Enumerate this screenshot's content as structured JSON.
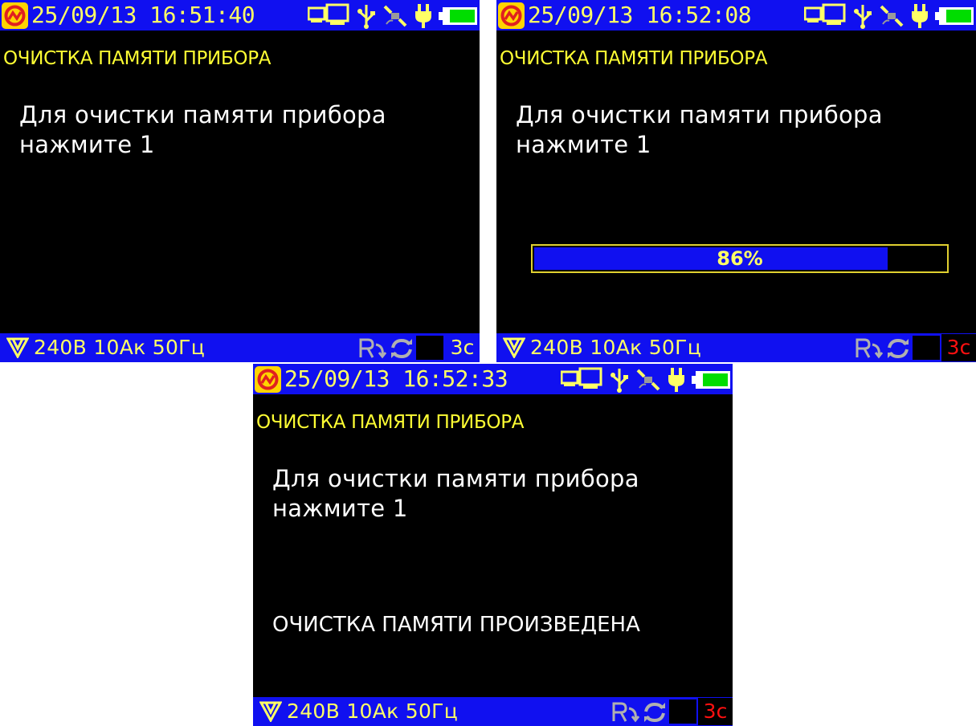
{
  "icons": [
    "logo-icon",
    "computer-icon",
    "usb-icon",
    "satellite-icon",
    "power-plug-icon",
    "battery-icon",
    "filter-icon",
    "recording-icon",
    "sync-icon"
  ],
  "colors": {
    "bar_blue": "#1010f0",
    "screen_black": "#000000",
    "header_text": "#ffff66",
    "title_text": "#ffff33",
    "body_text": "#ffffff",
    "timer_red": "#ff1010",
    "battery_green": "#00dd00",
    "logo_yellow": "#ffd400",
    "logo_red": "#e02020"
  },
  "screens": [
    {
      "datetime": "25/09/13 16:51:40",
      "title": "ОЧИСТКА ПАМЯТИ ПРИБОРА",
      "message_line1": "Для очистки памяти прибора",
      "message_line2": "нажмите 1",
      "status": "240В 10Ак 50Гц",
      "timer": "3с"
    },
    {
      "datetime": "25/09/13 16:52:08",
      "title": "ОЧИСТКА ПАМЯТИ ПРИБОРА",
      "message_line1": "Для очистки памяти прибора",
      "message_line2": "нажмите 1",
      "progress": {
        "label": "86%",
        "value": 0.86
      },
      "status": "240В 10Ак 50Гц",
      "timer": "3с"
    },
    {
      "datetime": "25/09/13 16:52:33",
      "title": "ОЧИСТКА ПАМЯТИ ПРИБОРА",
      "message_line1": "Для очистки памяти прибора",
      "message_line2": "нажмите 1",
      "done_message": "ОЧИСТКА ПАМЯТИ ПРОИЗВЕДЕНА",
      "status": "240В 10Ак 50Гц",
      "timer": "3с"
    }
  ]
}
